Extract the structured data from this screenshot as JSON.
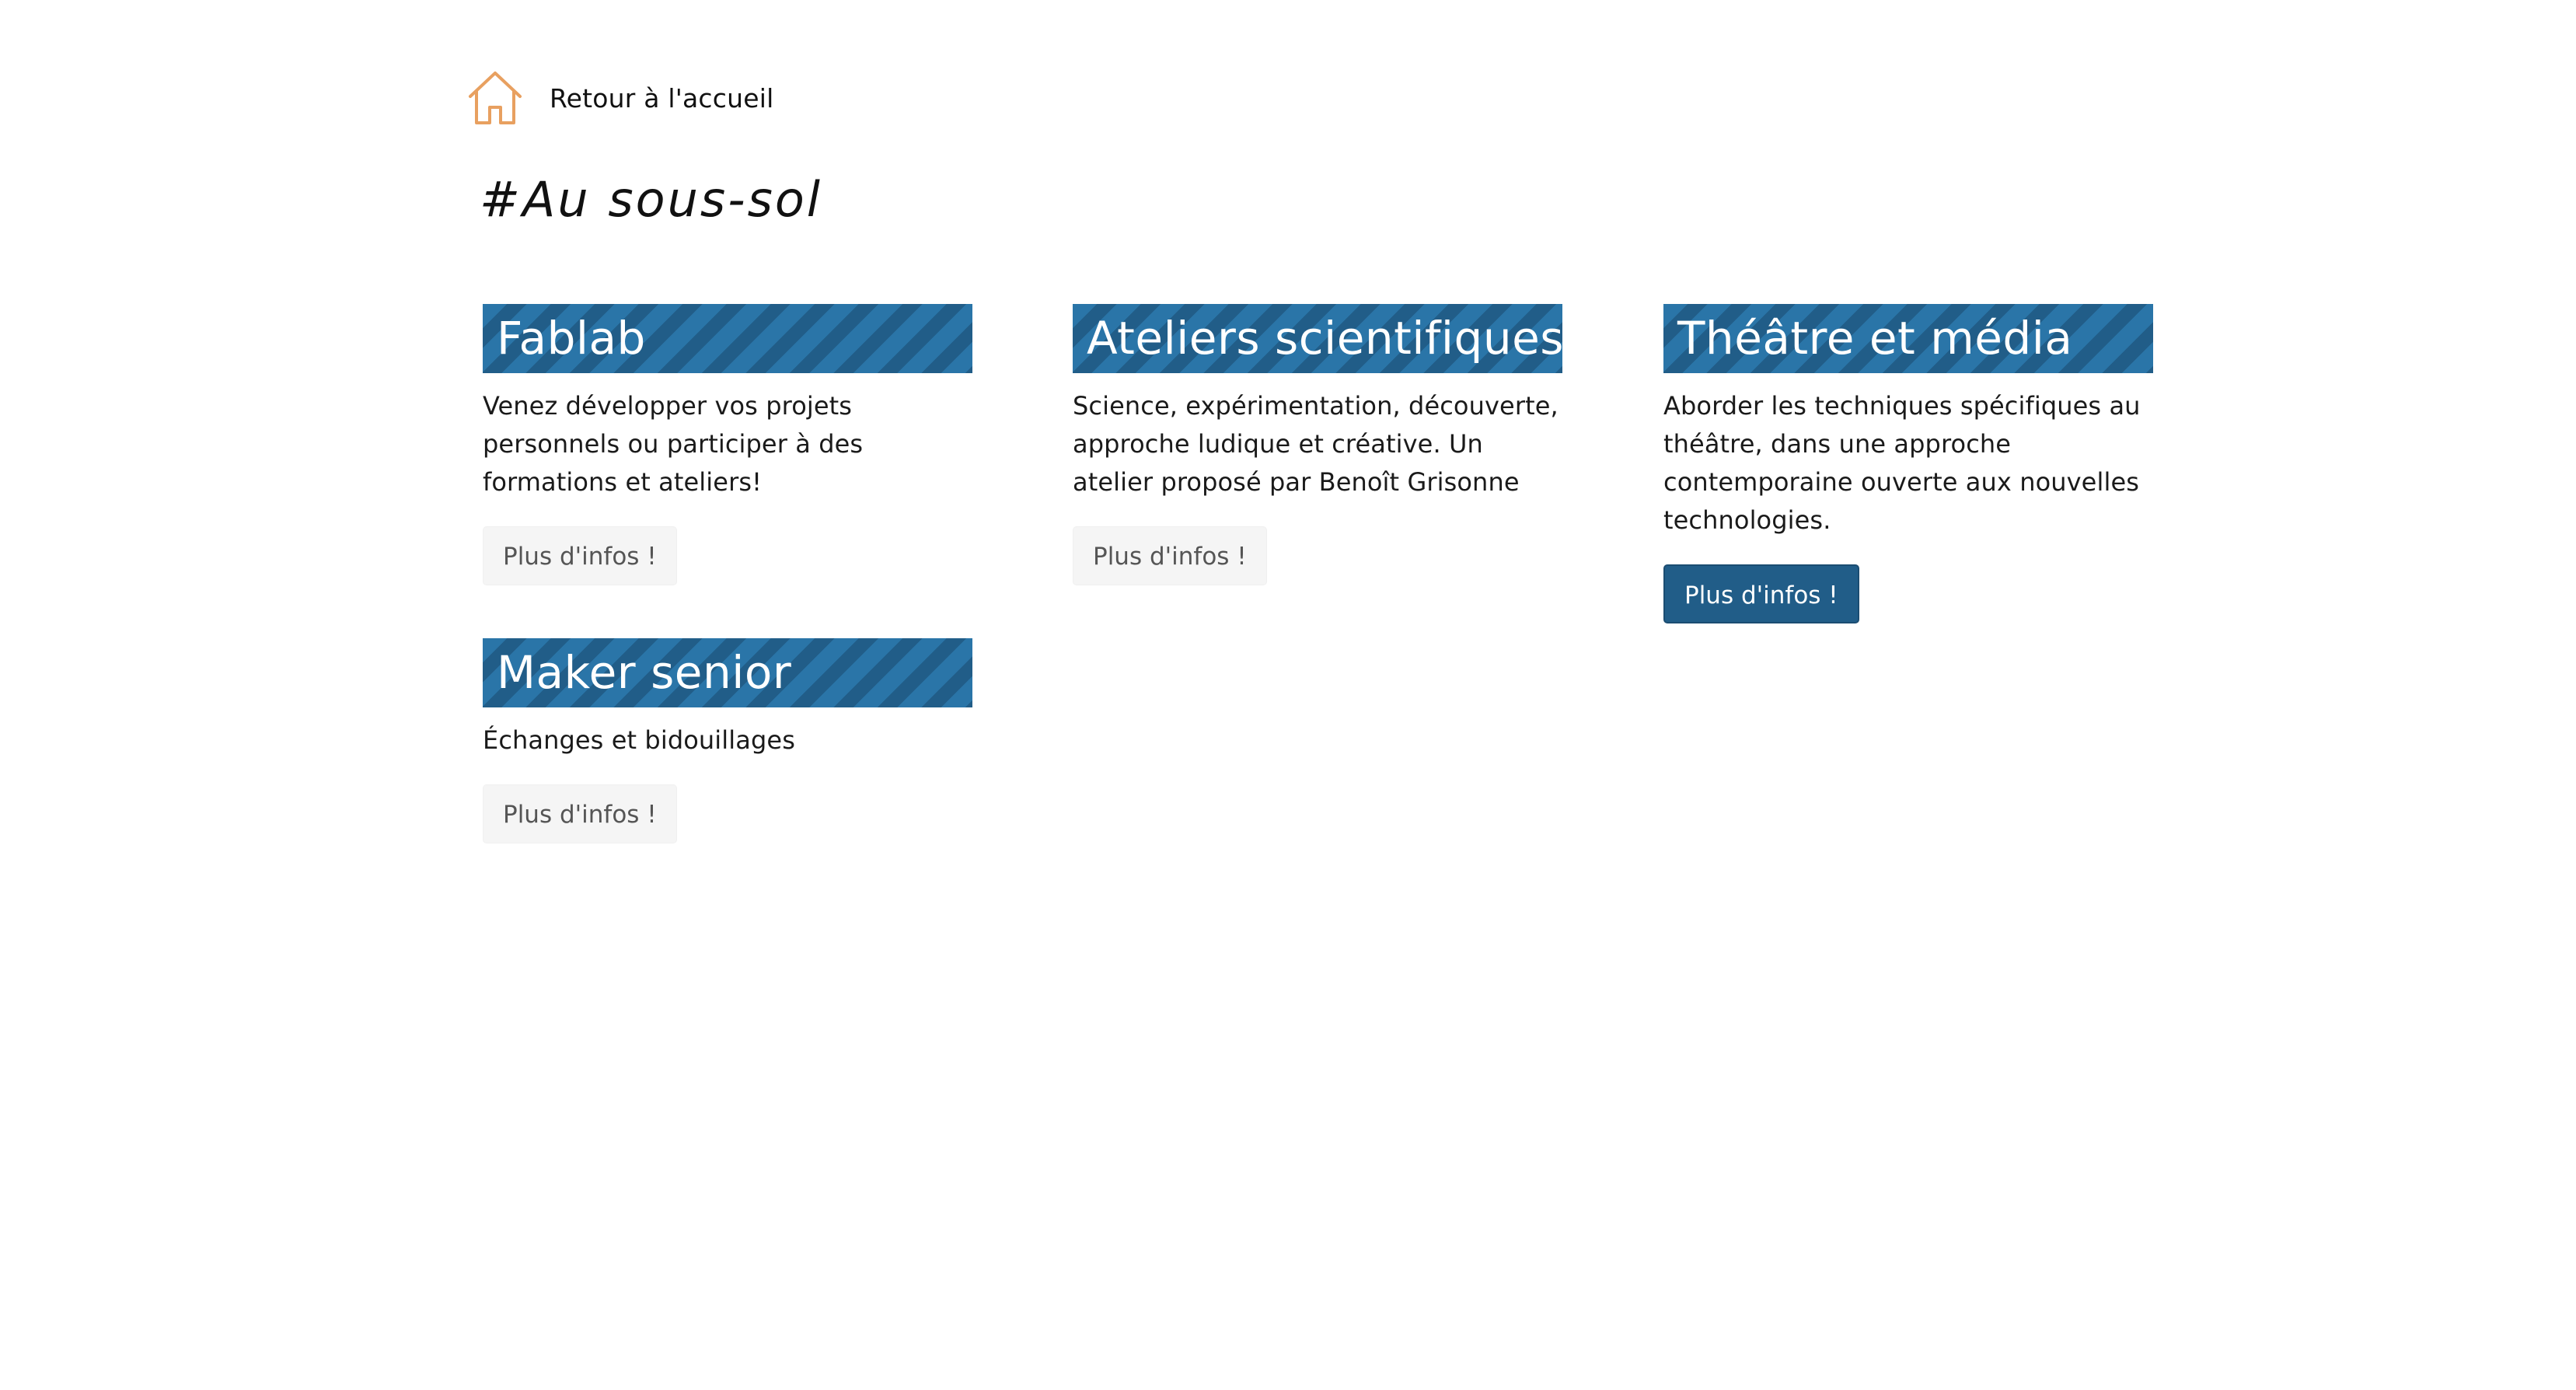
{
  "nav": {
    "home_label": "Retour à l'accueil",
    "home_icon": "home-icon",
    "home_icon_color": "#e8a060"
  },
  "page": {
    "title": "#Au sous-sol"
  },
  "colors": {
    "stripe_light": "#2a75a8",
    "stripe_dark": "#215d88",
    "button_active": "#215d88",
    "button_default": "#f5f5f5"
  },
  "cards": [
    {
      "title": "Fablab",
      "description": "Venez développer vos projets personnels ou participer à des formations et ateliers!",
      "button_label": "Plus d'infos !",
      "button_active": false
    },
    {
      "title": "Ateliers scientifiques",
      "description": "Science, expérimentation, découverte, approche ludique et créative. Un atelier proposé par Benoît Grisonne",
      "button_label": "Plus d'infos !",
      "button_active": false
    },
    {
      "title": "Théâtre et média",
      "description": "Aborder les techniques spécifiques au théâtre, dans une approche contemporaine ouverte aux nouvelles technologies.",
      "button_label": "Plus d'infos !",
      "button_active": true
    },
    {
      "title": "Maker senior",
      "description": "Échanges et bidouillages",
      "button_label": "Plus d'infos !",
      "button_active": false
    }
  ]
}
